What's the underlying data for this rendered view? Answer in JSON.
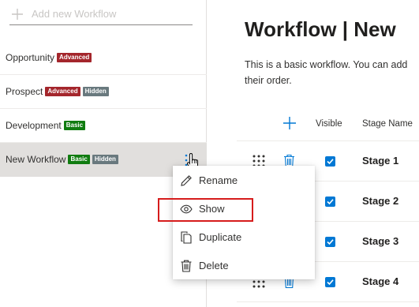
{
  "sidebar": {
    "add_label": "Add new Workflow",
    "items": [
      {
        "name": "Opportunity",
        "badges": [
          "Advanced"
        ]
      },
      {
        "name": "Prospect",
        "badges": [
          "Advanced",
          "Hidden"
        ]
      },
      {
        "name": "Development",
        "badges": [
          "Basic"
        ]
      },
      {
        "name": "New Workflow",
        "badges": [
          "Basic",
          "Hidden"
        ],
        "selected": true
      }
    ]
  },
  "main": {
    "title": "Workflow | New",
    "description_line1": "This is a basic workflow. You can add",
    "description_line2": "their order.",
    "table": {
      "visible_header": "Visible",
      "stage_header": "Stage Name",
      "rows": [
        {
          "name": "Stage 1",
          "visible": true
        },
        {
          "name": "Stage 2",
          "visible": true
        },
        {
          "name": "Stage 3",
          "visible": true
        },
        {
          "name": "Stage 4",
          "visible": true
        }
      ]
    }
  },
  "context_menu": {
    "items": [
      {
        "label": "Rename",
        "icon": "pencil-icon"
      },
      {
        "label": "Show",
        "icon": "eye-icon",
        "highlighted": true
      },
      {
        "label": "Duplicate",
        "icon": "copy-icon"
      },
      {
        "label": "Delete",
        "icon": "trash-icon"
      }
    ]
  },
  "colors": {
    "accent": "#0078d4",
    "badge_advanced": "#a4262c",
    "badge_basic": "#107c10",
    "badge_hidden": "#69797e",
    "highlight": "#d61c1c"
  }
}
